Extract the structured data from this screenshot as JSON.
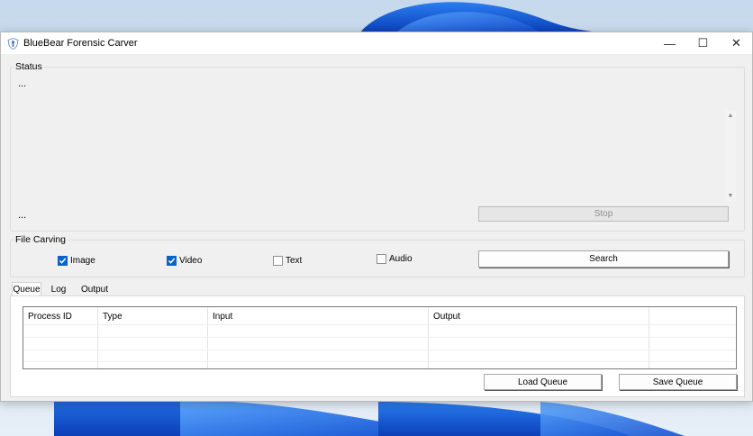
{
  "window": {
    "title": "BlueBear Forensic Carver",
    "controls": {
      "minimize": "—",
      "maximize": "☐",
      "close": "✕"
    }
  },
  "status": {
    "label": "Status",
    "top_text": "...",
    "bottom_text": "...",
    "stop_label": "Stop",
    "scroll_up": "▲",
    "scroll_down": "▼"
  },
  "file_carving": {
    "label": "File Carving",
    "options": [
      {
        "label": "Image",
        "checked": true
      },
      {
        "label": "Video",
        "checked": true
      },
      {
        "label": "Text",
        "checked": false
      },
      {
        "label": "Audio",
        "checked": false
      }
    ],
    "search_label": "Search"
  },
  "tabs": [
    {
      "label": "Queue",
      "active": true
    },
    {
      "label": "Log",
      "active": false
    },
    {
      "label": "Output",
      "active": false
    }
  ],
  "queue": {
    "columns": [
      "Process ID",
      "Type",
      "Input",
      "Output",
      ""
    ],
    "rows": [],
    "load_label": "Load Queue",
    "save_label": "Save Queue"
  },
  "colors": {
    "accent": "#0a63c6",
    "wallpaper": "#1a5fd6"
  }
}
